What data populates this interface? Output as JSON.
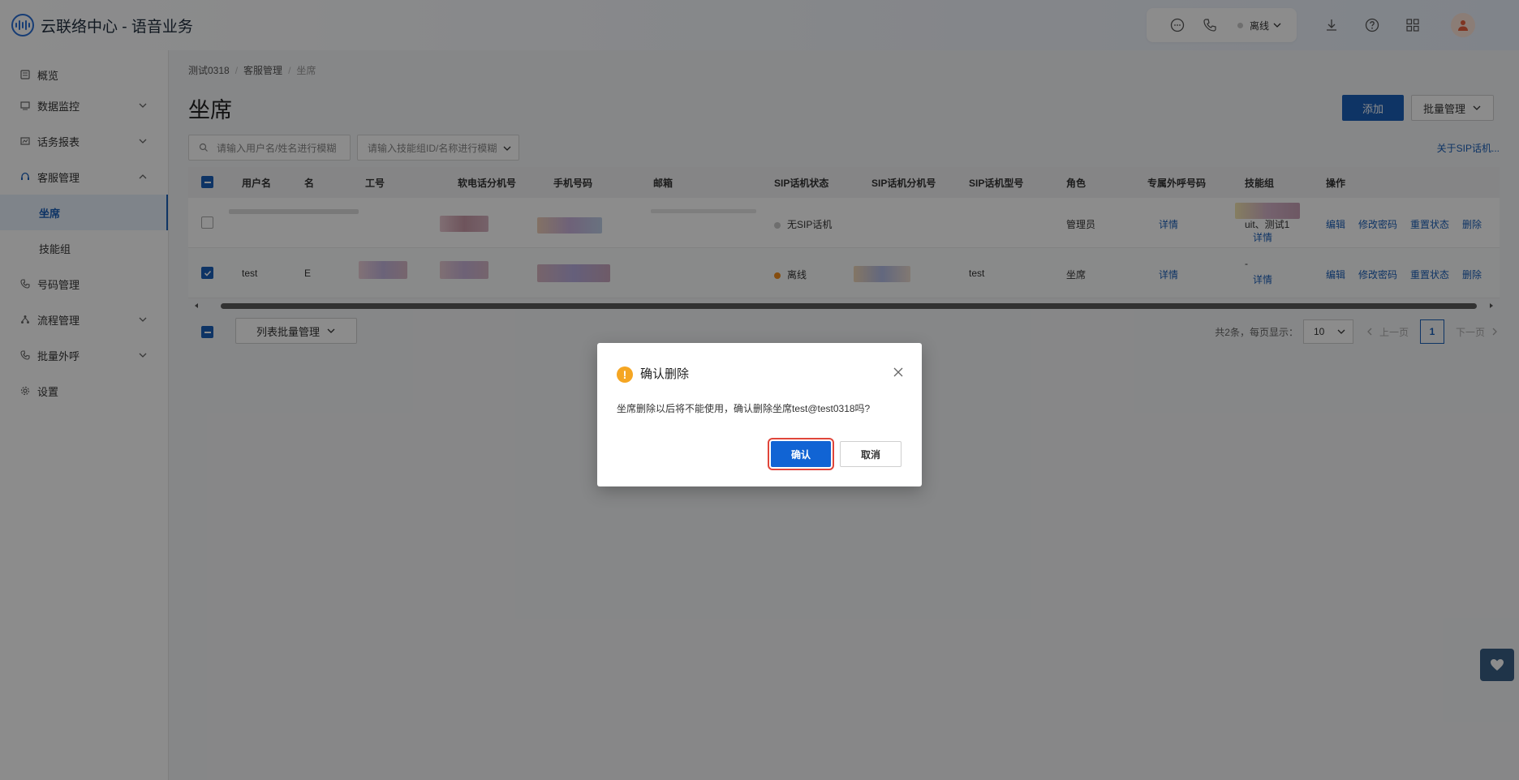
{
  "app": {
    "title": "云联络中心 - 语音业务"
  },
  "topbar": {
    "status_label": "离线",
    "icons": [
      "chat-icon",
      "phone-icon",
      "download-icon",
      "help-icon",
      "apps-icon"
    ]
  },
  "sidebar": {
    "items": [
      {
        "label": "概览",
        "icon": "overview-icon"
      },
      {
        "label": "数据监控",
        "icon": "monitor-icon"
      },
      {
        "label": "话务报表",
        "icon": "report-icon"
      },
      {
        "label": "客服管理",
        "icon": "headset-icon"
      },
      {
        "label": "坐席"
      },
      {
        "label": "技能组"
      },
      {
        "label": "号码管理",
        "icon": "phone-icon"
      },
      {
        "label": "流程管理",
        "icon": "flow-icon"
      },
      {
        "label": "批量外呼",
        "icon": "outbound-icon"
      },
      {
        "label": "设置",
        "icon": "gear-icon"
      }
    ]
  },
  "breadcrumb": {
    "items": [
      "测试0318",
      "客服管理",
      "坐席"
    ]
  },
  "page": {
    "title": "坐席",
    "add_label": "添加",
    "batch_label": "批量管理",
    "search_user_placeholder": "请输入用户名/姓名进行模糊",
    "search_skill_placeholder": "请输入技能组ID/名称进行模糊",
    "about_sip_link": "关于SIP话机..."
  },
  "table": {
    "columns": [
      "用户名",
      "名",
      "工号",
      "软电话分机号",
      "手机号码",
      "邮箱",
      "SIP话机状态",
      "SIP话机分机号",
      "SIP话机型号",
      "角色",
      "专属外呼号码",
      "技能组",
      "操作"
    ],
    "rows": [
      {
        "username": "",
        "sip_status": "无SIP话机",
        "sip_status_color": "#c8c8c8",
        "sip_model": "",
        "role": "管理员",
        "exclusive_number": "详情",
        "skill_text": "uit、测试1",
        "skill_link": "详情",
        "actions": [
          "编辑",
          "修改密码",
          "重置状态",
          "删除"
        ]
      },
      {
        "username": "test",
        "name_partial": "E",
        "sip_status": "离线",
        "sip_status_color": "#f28c1c",
        "sip_model": "test",
        "role": "坐席",
        "exclusive_number": "详情",
        "skill_text": "-",
        "skill_link": "详情",
        "actions": [
          "编辑",
          "修改密码",
          "重置状态",
          "删除"
        ]
      }
    ]
  },
  "footer": {
    "batch_list_label": "列表批量管理",
    "total_text": "共2条，每页显示：",
    "page_size": "10",
    "prev_label": "上一页",
    "current_page": "1",
    "next_label": "下一页"
  },
  "dialog": {
    "title": "确认删除",
    "message": "坐席删除以后将不能使用，确认删除坐席test@test0318吗?",
    "confirm_label": "确认",
    "cancel_label": "取消"
  }
}
